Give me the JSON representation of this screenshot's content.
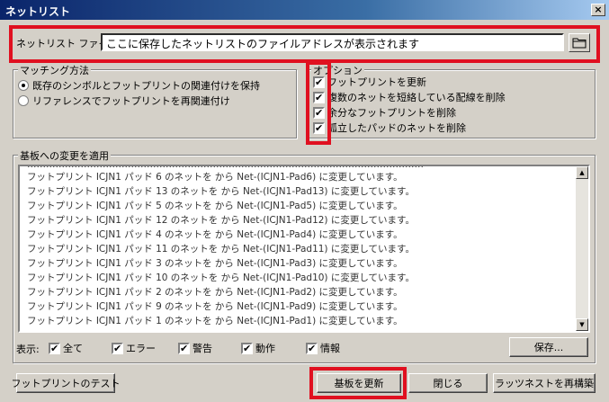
{
  "window": {
    "title": "ネットリスト",
    "close_label": "×"
  },
  "netlist_file": {
    "label": "ネットリスト ファイル:",
    "value": "ここに保存したネットリストのファイルアドレスが表示されます"
  },
  "matching": {
    "title": "マッチング方法",
    "options": [
      {
        "label": "既存のシンボルとフットプリントの関連付けを保持",
        "selected": true
      },
      {
        "label": "リファレンスでフットプリントを再関連付け",
        "selected": false
      }
    ]
  },
  "options_group": {
    "title": "オプション",
    "items": [
      {
        "label": "フットプリントを更新",
        "checked": true
      },
      {
        "label": "複数のネットを短絡している配線を削除",
        "checked": true
      },
      {
        "label": "余分なフットプリントを削除",
        "checked": true
      },
      {
        "label": "孤立したパッドのネットを削除",
        "checked": true
      }
    ]
  },
  "apply_group": {
    "title": "基板への変更を適用"
  },
  "log_lines": [
    "フットプリント ICJN1 パッド 6 のネットを から Net-(ICJN1-Pad6) に変更しています。",
    "フットプリント ICJN1 パッド 13 のネットを から Net-(ICJN1-Pad13) に変更しています。",
    "フットプリント ICJN1 パッド 5 のネットを から Net-(ICJN1-Pad5) に変更しています。",
    "フットプリント ICJN1 パッド 12 のネットを から Net-(ICJN1-Pad12) に変更しています。",
    "フットプリント ICJN1 パッド 4 のネットを から Net-(ICJN1-Pad4) に変更しています。",
    "フットプリント ICJN1 パッド 11 のネットを から Net-(ICJN1-Pad11) に変更しています。",
    "フットプリント ICJN1 パッド 3 のネットを から Net-(ICJN1-Pad3) に変更しています。",
    "フットプリント ICJN1 パッド 10 のネットを から Net-(ICJN1-Pad10) に変更しています。",
    "フットプリント ICJN1 パッド 2 のネットを から Net-(ICJN1-Pad2) に変更しています。",
    "フットプリント ICJN1 パッド 9 のネットを から Net-(ICJN1-Pad9) に変更しています。",
    "フットプリント ICJN1 パッド 1 のネットを から Net-(ICJN1-Pad1) に変更しています。"
  ],
  "filters": {
    "label": "表示:",
    "items": [
      {
        "label": "全て",
        "checked": true
      },
      {
        "label": "エラー",
        "checked": true
      },
      {
        "label": "警告",
        "checked": true
      },
      {
        "label": "動作",
        "checked": true
      },
      {
        "label": "情報",
        "checked": true
      }
    ],
    "save_label": "保存..."
  },
  "buttons": {
    "test_footprints": "フットプリントのテスト",
    "update_pcb": "基板を更新",
    "close": "閉じる",
    "rebuild_ratsnest": "ラッツネストを再構築"
  },
  "check_mark": "✔"
}
